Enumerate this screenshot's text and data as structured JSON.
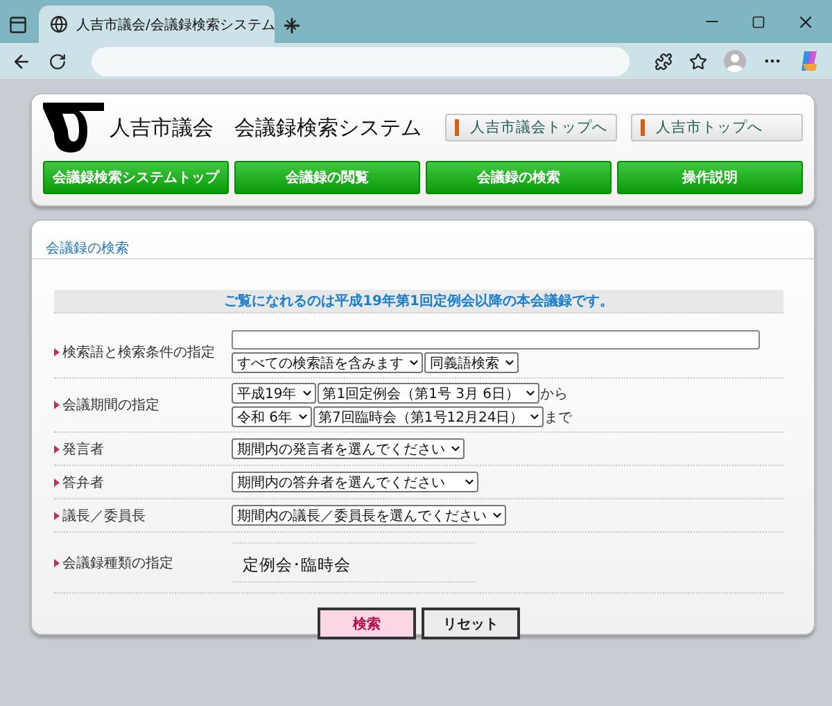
{
  "browser": {
    "tab_title": "人吉市議会/会議録検索システム"
  },
  "header": {
    "title": "人吉市議会　会議録検索システム",
    "links": [
      "人吉市議会トップへ",
      "人吉市トップへ"
    ],
    "nav": [
      "会議録検索システムトップ",
      "会議録の閲覧",
      "会議録の検索",
      "操作説明"
    ]
  },
  "search": {
    "heading": "会議録の検索",
    "notice": "ご覧になれるのは平成19年第1回定例会以降の本会議録です。",
    "rows": [
      {
        "kind": "keyword",
        "label": "検索語と検索条件の指定",
        "selects": [
          "すべての検索語を含みます",
          "同義語検索"
        ]
      },
      {
        "kind": "period",
        "label": "会議期間の指定",
        "lines": [
          {
            "selects": [
              "平成19年",
              "第1回定例会（第1号 3月 6日）"
            ],
            "suffix": "から"
          },
          {
            "selects": [
              "令和 6年",
              "第7回臨時会（第1号12月24日）"
            ],
            "suffix": "まで"
          }
        ]
      },
      {
        "kind": "select",
        "label": "発言者",
        "selects": [
          "期間内の発言者を選んでください"
        ]
      },
      {
        "kind": "select",
        "label": "答弁者",
        "selects": [
          "期間内の答弁者を選んでください　"
        ]
      },
      {
        "kind": "select",
        "label": "議長／委員長",
        "selects": [
          "期間内の議長／委員長を選んでください"
        ]
      },
      {
        "kind": "text",
        "label": "会議録種類の指定",
        "value": "定例会･臨時会"
      }
    ],
    "buttons": [
      {
        "label": "検索",
        "kind": "primary"
      },
      {
        "label": "リセット",
        "kind": "secondary"
      }
    ]
  }
}
